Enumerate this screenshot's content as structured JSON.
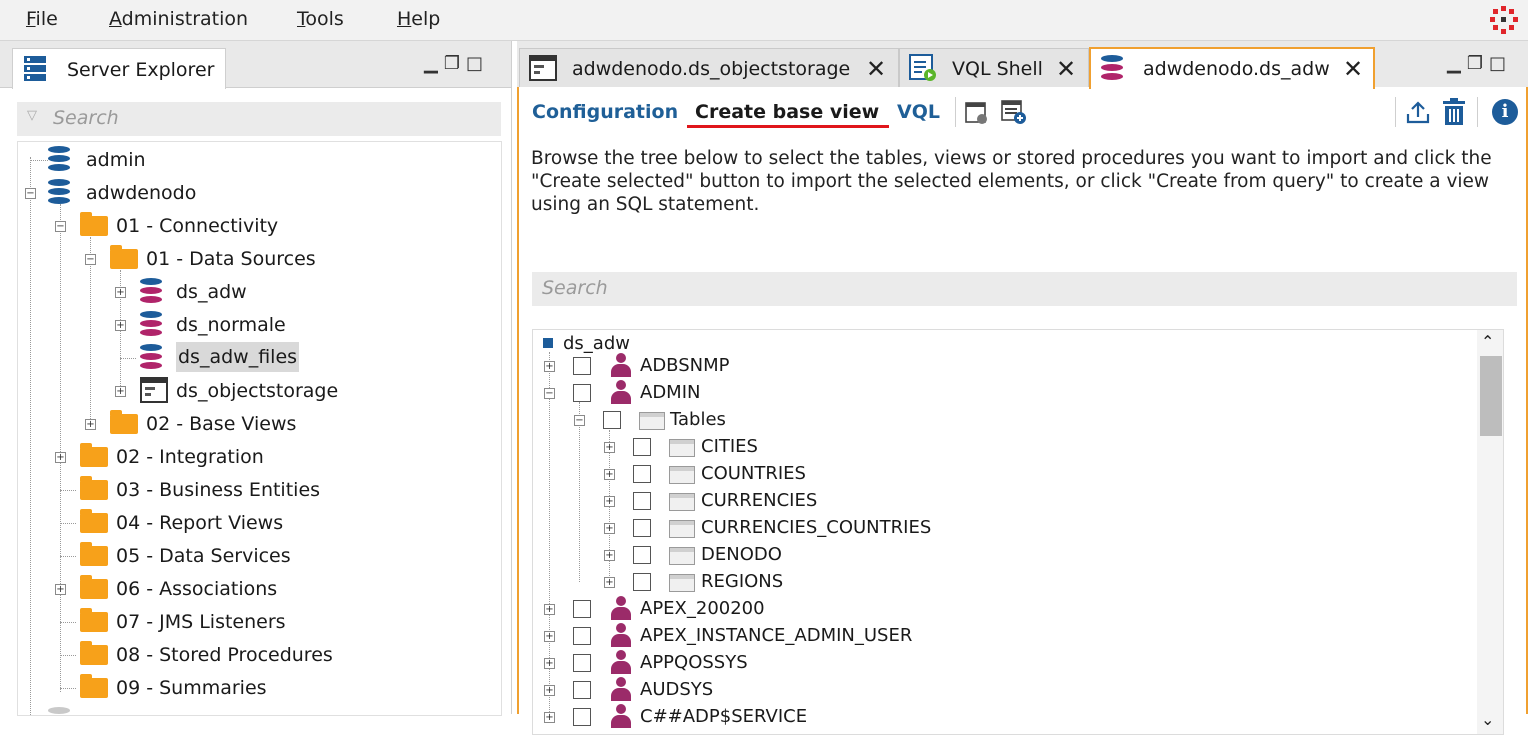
{
  "menu": {
    "items": [
      {
        "key": "F",
        "rest": "ile"
      },
      {
        "key": "A",
        "rest": "dministration"
      },
      {
        "key": "T",
        "rest": "ools"
      },
      {
        "key": "H",
        "rest": "elp"
      }
    ]
  },
  "left_panel": {
    "tab_label": "Server Explorer",
    "search_placeholder": "Search",
    "tree": [
      {
        "label": "admin"
      },
      {
        "label": "adwdenodo"
      },
      {
        "label": "01 - Connectivity"
      },
      {
        "label": "01 - Data Sources"
      },
      {
        "label": "ds_adw"
      },
      {
        "label": "ds_normale"
      },
      {
        "label": "ds_adw_files"
      },
      {
        "label": "ds_objectstorage"
      },
      {
        "label": "02 - Base Views"
      },
      {
        "label": "02 - Integration"
      },
      {
        "label": "03 - Business Entities"
      },
      {
        "label": "04 - Report Views"
      },
      {
        "label": "05 - Data Services"
      },
      {
        "label": "06 - Associations"
      },
      {
        "label": "07 - JMS Listeners"
      },
      {
        "label": "08 - Stored Procedures"
      },
      {
        "label": "09 - Summaries"
      }
    ]
  },
  "right_panel": {
    "tabs": [
      {
        "label": "adwdenodo.ds_objectstorage"
      },
      {
        "label": "VQL Shell"
      },
      {
        "label": "adwdenodo.ds_adw"
      }
    ],
    "subtabs": {
      "configuration": "Configuration",
      "create_base_view": "Create base view",
      "vql": "VQL"
    },
    "description": "Browse the tree below to select the tables, views or stored procedures you want to import and click the \"Create selected\" button to import the selected elements, or click \"Create from query\" to create a view using an SQL statement.",
    "search_placeholder": "Search",
    "tree_root": "ds_adw",
    "tree": [
      {
        "label": "ADBSNMP"
      },
      {
        "label": "ADMIN"
      },
      {
        "label": "Tables"
      },
      {
        "label": "CITIES"
      },
      {
        "label": "COUNTRIES"
      },
      {
        "label": "CURRENCIES"
      },
      {
        "label": "CURRENCIES_COUNTRIES"
      },
      {
        "label": "DENODO"
      },
      {
        "label": "REGIONS"
      },
      {
        "label": "APEX_200200"
      },
      {
        "label": "APEX_INSTANCE_ADMIN_USER"
      },
      {
        "label": "APPQOSSYS"
      },
      {
        "label": "AUDSYS"
      },
      {
        "label": "C##ADP$SERVICE"
      }
    ]
  },
  "colors": {
    "accent_orange": "#f0a030",
    "subtab_blue": "#1f5f97",
    "underline_red": "#e0161b",
    "folder": "#f7a11a",
    "user_icon": "#9b2b69",
    "db_blue": "#1d5c9a",
    "db_magenta": "#b0246a"
  }
}
